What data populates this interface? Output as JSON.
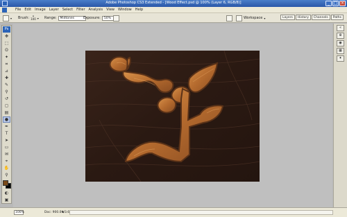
{
  "window": {
    "title": "Adobe Photoshop CS3 Extended - [Wood Effect.psd @ 100% (Layer 6, RGB/8)]",
    "buttons": [
      "_",
      "□",
      "×"
    ]
  },
  "menubar": {
    "items": [
      "File",
      "Edit",
      "Image",
      "Layer",
      "Select",
      "Filter",
      "Analysis",
      "View",
      "Window",
      "Help"
    ]
  },
  "options": {
    "brush_label": "Brush:",
    "brush_size": "100",
    "range_label": "Range:",
    "range_value": "Midtones",
    "exposure_label": "Exposure:",
    "exposure_value": "50%",
    "workspace_label": "Workspace"
  },
  "panelwell": {
    "tabs": [
      "Layers",
      "History",
      "Channels",
      "Paths"
    ]
  },
  "toolbox": {
    "badge": "Ps",
    "tools": [
      "move-tool",
      "marquee-tool",
      "lasso-tool",
      "magic-wand-tool",
      "crop-tool",
      "slice-tool",
      "healing-brush-tool",
      "brush-tool",
      "clone-stamp-tool",
      "history-brush-tool",
      "eraser-tool",
      "gradient-tool",
      "burn-tool",
      "pen-tool",
      "type-tool",
      "path-selection-tool",
      "shape-tool",
      "notes-tool",
      "eyedropper-tool",
      "hand-tool",
      "zoom-tool"
    ],
    "tool_glyphs": [
      "✥",
      "⬚",
      "ʘ",
      "✦",
      "⌗",
      "⊿",
      "✚",
      "✎",
      "⚲",
      "↺",
      "◻",
      "▤",
      "●",
      "✒",
      "T",
      "➤",
      "▭",
      "✉",
      "⌖",
      "✋",
      "⚲"
    ],
    "active_tool": "burn-tool",
    "foreground_color": "#7a4a1a",
    "background_color": "#000000"
  },
  "status": {
    "zoom": "100%",
    "doc": "Doc: 900.0K/3.68M"
  },
  "colors": {
    "wood_dark": "#2b1a12",
    "wood_light": "#c27a3a"
  }
}
